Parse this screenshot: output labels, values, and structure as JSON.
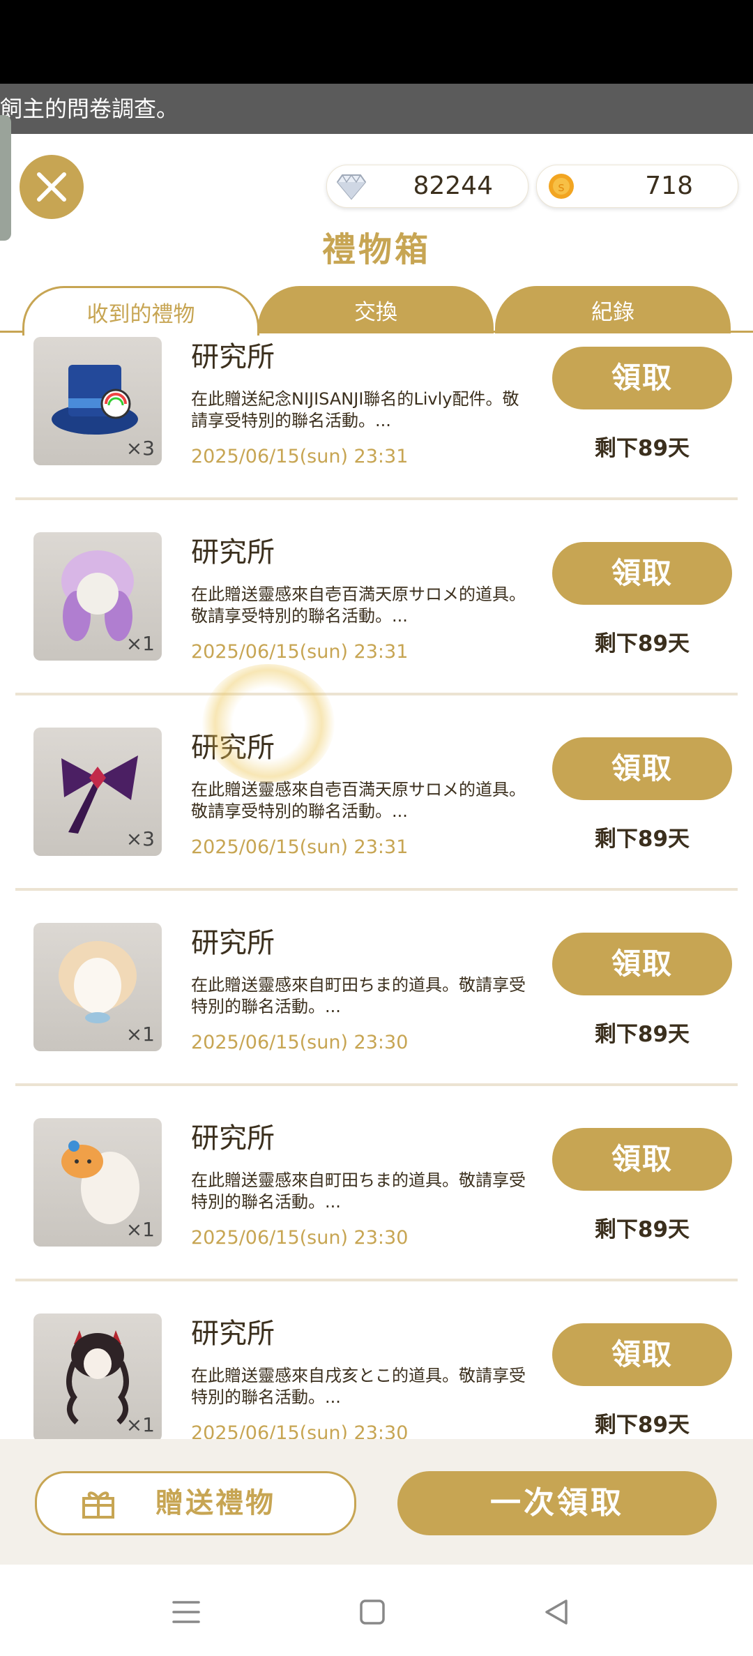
{
  "banner": {
    "text": "飼主的問卷調查。"
  },
  "header": {
    "title": "禮物箱",
    "diamonds": "82244",
    "coins": "718"
  },
  "tabs": [
    {
      "label": "收到的禮物",
      "active": true
    },
    {
      "label": "交換",
      "active": false
    },
    {
      "label": "紀錄",
      "active": false
    }
  ],
  "items": [
    {
      "sender": "研究所",
      "desc": "在此贈送紀念NIJISANJI聯名的Livly配件。敬請享受特別的聯名活動。...",
      "date": "2025/06/15(sun) 23:31",
      "qty": "×3",
      "claim": "領取",
      "remaining": "剩下89天",
      "icon": "top-hat-icon"
    },
    {
      "sender": "研究所",
      "desc": "在此贈送靈感來自壱百満天原サロメ的道具。敬請享受特別的聯名活動。...",
      "date": "2025/06/15(sun) 23:31",
      "qty": "×1",
      "claim": "領取",
      "remaining": "剩下89天",
      "icon": "purple-wig-icon"
    },
    {
      "sender": "研究所",
      "desc": "在此贈送靈感來自壱百満天原サロメ的道具。敬請享受特別的聯名活動。...",
      "date": "2025/06/15(sun) 23:31",
      "qty": "×3",
      "claim": "領取",
      "remaining": "剩下89天",
      "icon": "purple-bow-icon"
    },
    {
      "sender": "研究所",
      "desc": "在此贈送靈感來自町田ちま的道具。敬請享受特別的聯名活動。...",
      "date": "2025/06/15(sun) 23:30",
      "qty": "×1",
      "claim": "領取",
      "remaining": "剩下89天",
      "icon": "blonde-wig-icon"
    },
    {
      "sender": "研究所",
      "desc": "在此贈送靈感來自町田ちま的道具。敬請享受特別的聯名活動。...",
      "date": "2025/06/15(sun) 23:30",
      "qty": "×1",
      "claim": "領取",
      "remaining": "剩下89天",
      "icon": "hamster-hat-icon"
    },
    {
      "sender": "研究所",
      "desc": "在此贈送靈感來自戌亥とこ的道具。敬請享受特別的聯名活動。...",
      "date": "2025/06/15(sun) 23:30",
      "qty": "×1",
      "claim": "領取",
      "remaining": "剩下89天",
      "icon": "dark-wig-icon"
    }
  ],
  "footer": {
    "send_label": "贈送禮物",
    "claim_all_label": "一次領取"
  },
  "colors": {
    "accent": "#c7a553",
    "text": "#3b2f1d"
  }
}
